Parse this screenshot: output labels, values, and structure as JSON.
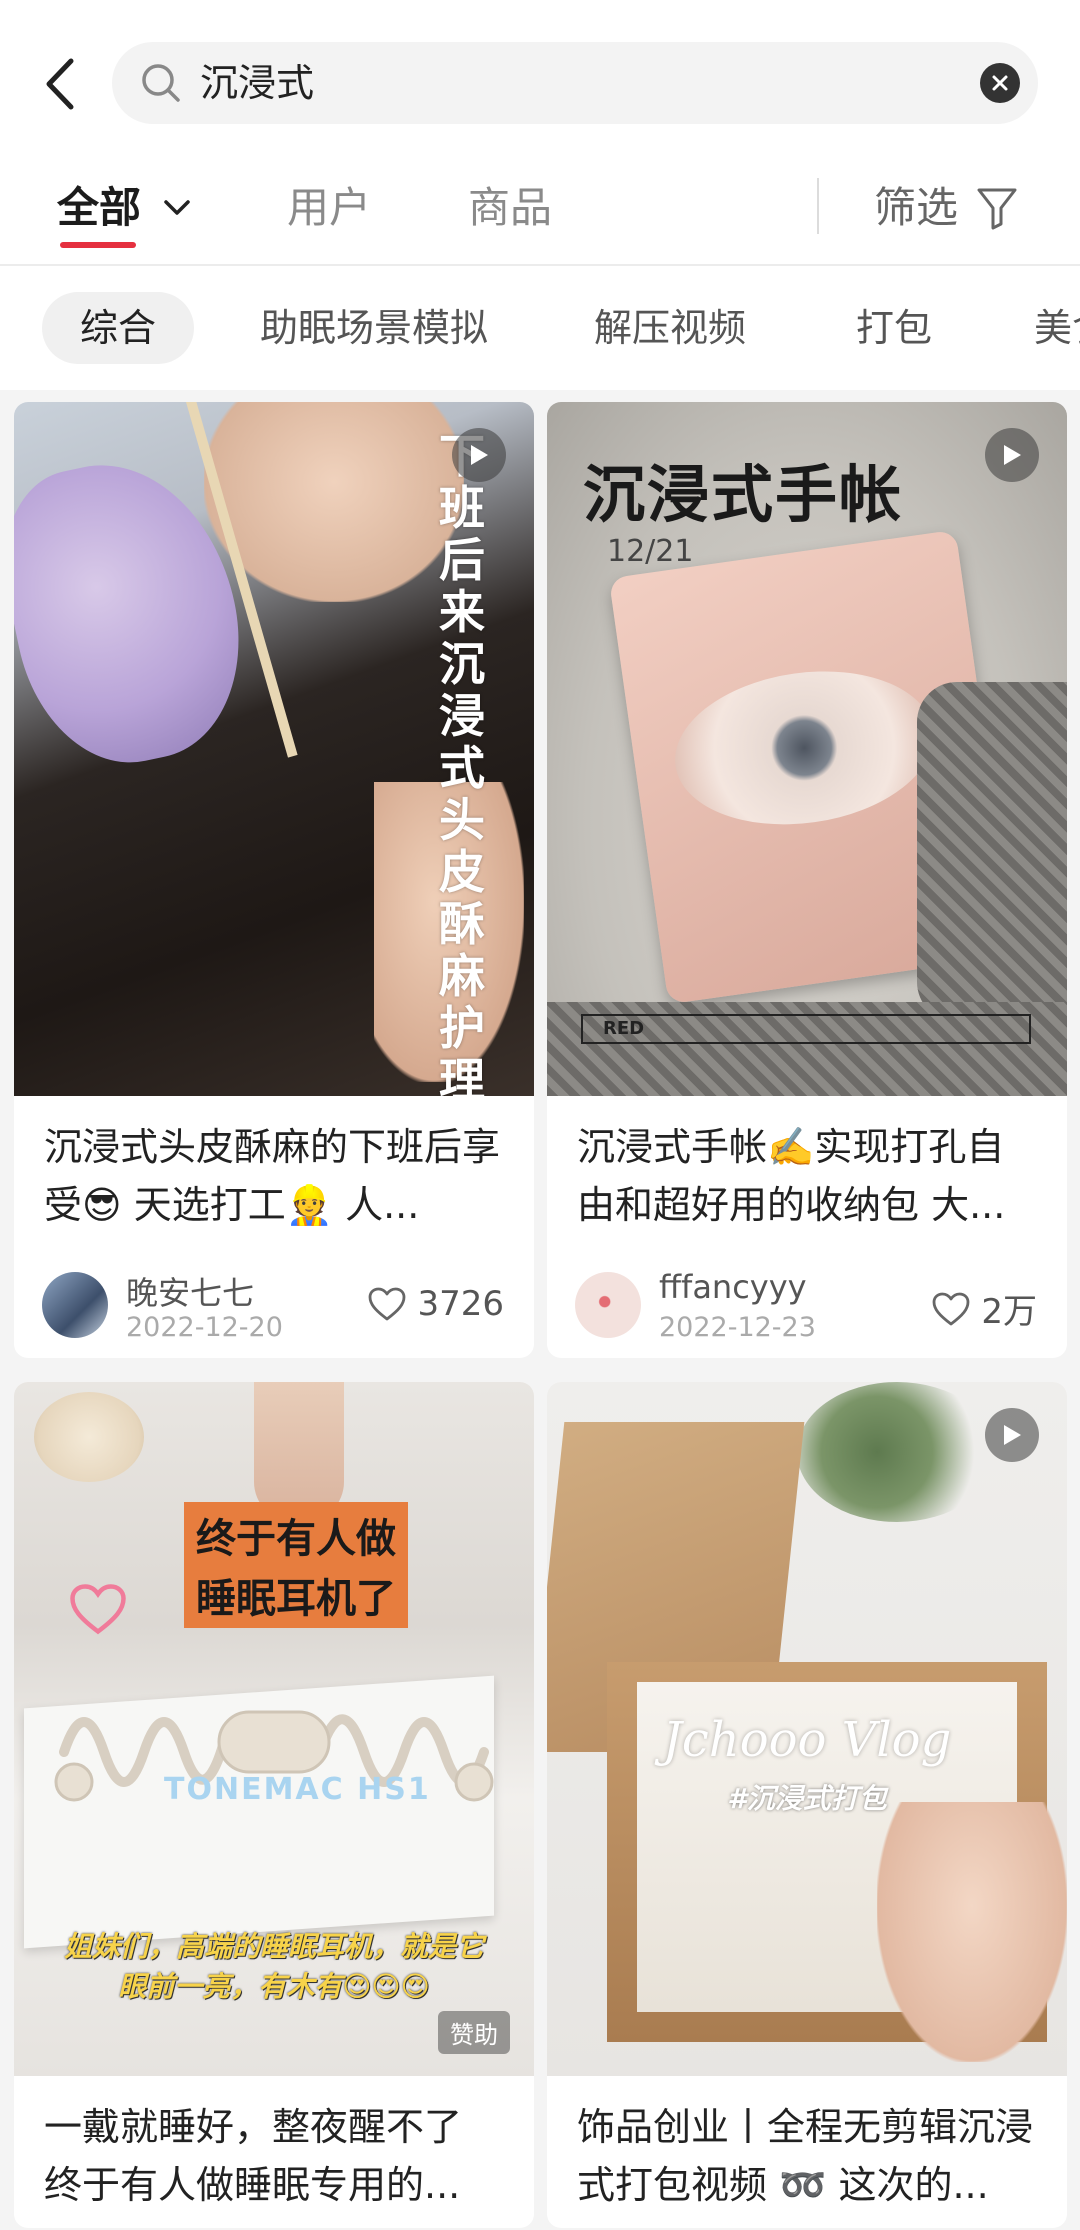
{
  "search": {
    "query": "沉浸式"
  },
  "tabs": {
    "all": "全部",
    "users": "用户",
    "products": "商品",
    "filter": "筛选"
  },
  "chips": [
    "综合",
    "助眠场景模拟",
    "解压视频",
    "打包",
    "美食"
  ],
  "cards": [
    {
      "overlay": "下班后来沉浸式头皮酥麻护理",
      "title": "沉浸式头皮酥麻的下班后享受😎 天选打工👷 人...",
      "author": "晚安七七",
      "date": "2022-12-20",
      "likes": "3726"
    },
    {
      "overlay": "沉浸式手帐",
      "overlay_date": "12/21",
      "overlay_badge": "RED",
      "title": "沉浸式手帐✍️实现打孔自由和超好用的收纳包 大...",
      "author": "fffancyyy",
      "date": "2022-12-23",
      "likes": "2万"
    },
    {
      "overlay_line1": "终于有人做",
      "overlay_line2": "睡眠耳机了",
      "overlay_product": "TONEMAC HS1",
      "overlay_caption1": "姐妹们，高端的睡眠耳机，就是它",
      "overlay_caption2": "眼前一亮，有木有😍😍😍",
      "sponsor": "赞助",
      "title": "一戴就睡好，整夜醒不了 终于有人做睡眠专用的..."
    },
    {
      "overlay": "Jchooo Vlog",
      "overlay_sub": "#沉浸式打包",
      "title": "饰品创业丨全程无剪辑沉浸式打包视频 ➿ 这次的..."
    }
  ],
  "colors": {
    "accent": "#e5303f",
    "feed_bg": "#f4f4f4"
  }
}
